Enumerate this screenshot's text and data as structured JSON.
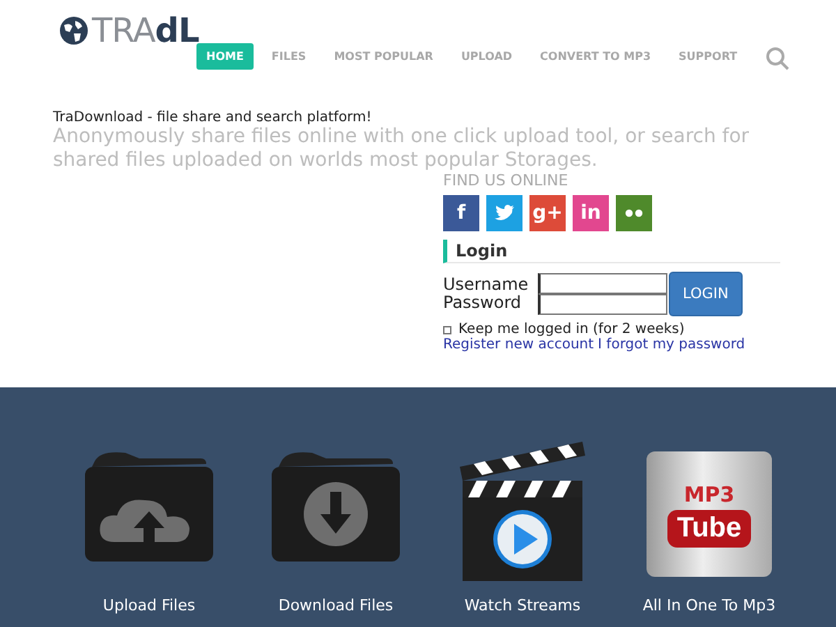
{
  "header": {
    "logo": "TRA**dL**",
    "nav": [
      {
        "label": "HOME",
        "selected": true
      },
      {
        "label": "FILES",
        "selected": false
      },
      {
        "label": "MOST POPULAR",
        "selected": false
      },
      {
        "label": "UPLOAD",
        "selected": false
      },
      {
        "label": "CONVERT TO MP3",
        "selected": false
      },
      {
        "label": "SUPPORT",
        "selected": false
      }
    ]
  },
  "intro": {
    "tagline": "TraDownload - file share and search platform!",
    "description": "Anonymously share files online with one click upload tool, or search for shared files uploaded on worlds most popular Storages."
  },
  "social": {
    "heading": "FIND US ONLINE",
    "links": [
      {
        "kind": "facebook",
        "glyph": "f",
        "color": "#3b5998"
      },
      {
        "kind": "twitter",
        "color": "#1da1e2"
      },
      {
        "kind": "googleplus",
        "glyph": "g+",
        "color": "#dd4b39"
      },
      {
        "kind": "linkedin",
        "glyph": "in",
        "color": "#e2478f"
      },
      {
        "kind": "flickr",
        "color": "#4f8a2b"
      }
    ]
  },
  "login": {
    "heading": "Login",
    "username_label": "Username",
    "password_label": "Password",
    "button": "LOGIN",
    "remember": {
      "label": "Keep me logged in (for 2 weeks)",
      "checked": false
    },
    "links": [
      "Register new account",
      "I forgot my password"
    ]
  },
  "features": [
    {
      "kind": "upload",
      "label": "Upload Files"
    },
    {
      "kind": "download",
      "label": "Download Files"
    },
    {
      "kind": "stream",
      "label": "Watch Streams"
    },
    {
      "kind": "mp3",
      "label": "All In One To Mp3",
      "badge_top": "MP3",
      "badge_bottom": "Tube"
    }
  ]
}
